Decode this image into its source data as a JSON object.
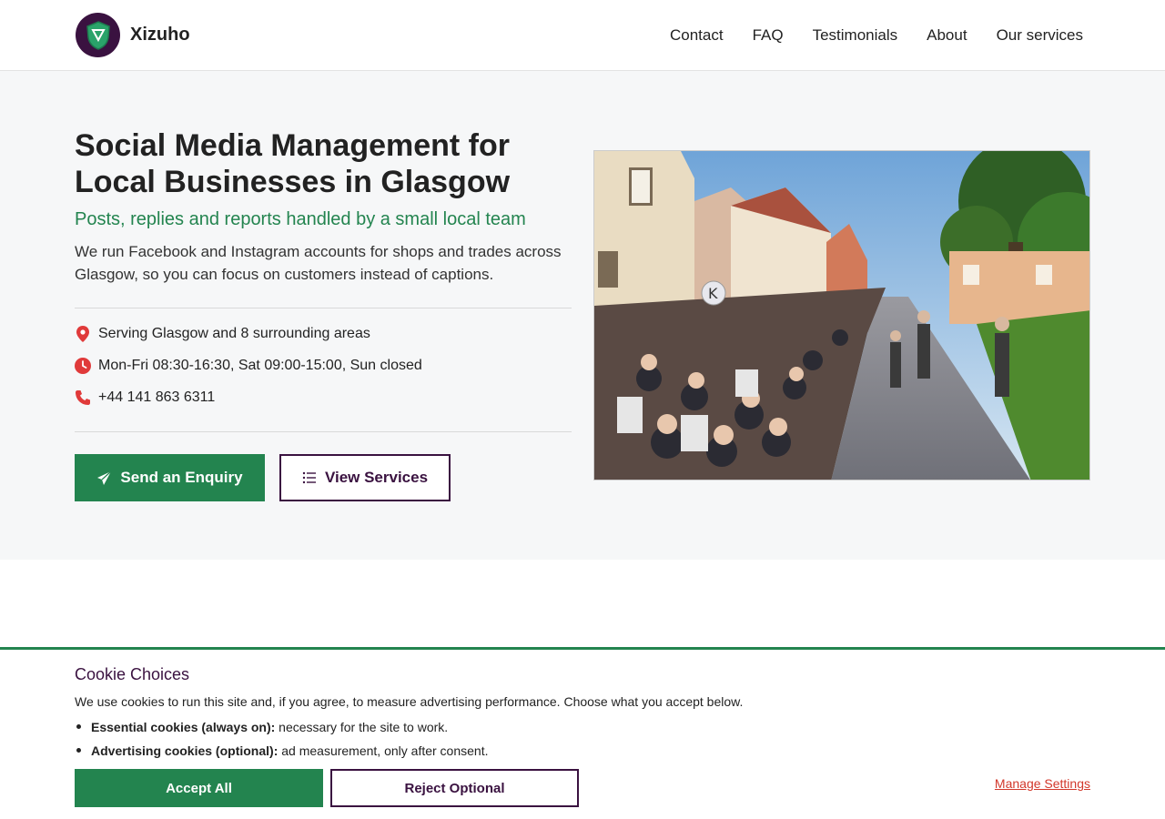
{
  "brand": {
    "name": "Xizuho"
  },
  "nav": [
    "Contact",
    "FAQ",
    "Testimonials",
    "About",
    "Our services"
  ],
  "hero": {
    "title": "Social Media Management for Local Businesses in Glasgow",
    "subtitle": "Posts, replies and reports handled by a small local team",
    "description": "We run Facebook and Instagram accounts for shops and trades across Glasgow, so you can focus on customers instead of captions.",
    "info": {
      "area": "Serving Glasgow and 8 surrounding areas",
      "hours": "Mon-Fri 08:30-16:30, Sat 09:00-15:00, Sun closed",
      "phone": "+44 141 863 6311"
    },
    "primary_button": "Send an Enquiry",
    "secondary_button": "View Services"
  },
  "cookie": {
    "title": "Cookie Choices",
    "text": "We use cookies to run this site and, if you agree, to measure advertising performance. Choose what you accept below.",
    "essential_label": "Essential cookies (always on):",
    "essential_desc": " necessary for the site to work.",
    "advertising_label": "Advertising cookies (optional):",
    "advertising_desc": " ad measurement, only after consent.",
    "accept": "Accept All",
    "reject": "Reject Optional",
    "manage": "Manage Settings"
  },
  "colors": {
    "accent_green": "#23844f",
    "brand_purple": "#3a1240",
    "link_red": "#d2382b"
  }
}
